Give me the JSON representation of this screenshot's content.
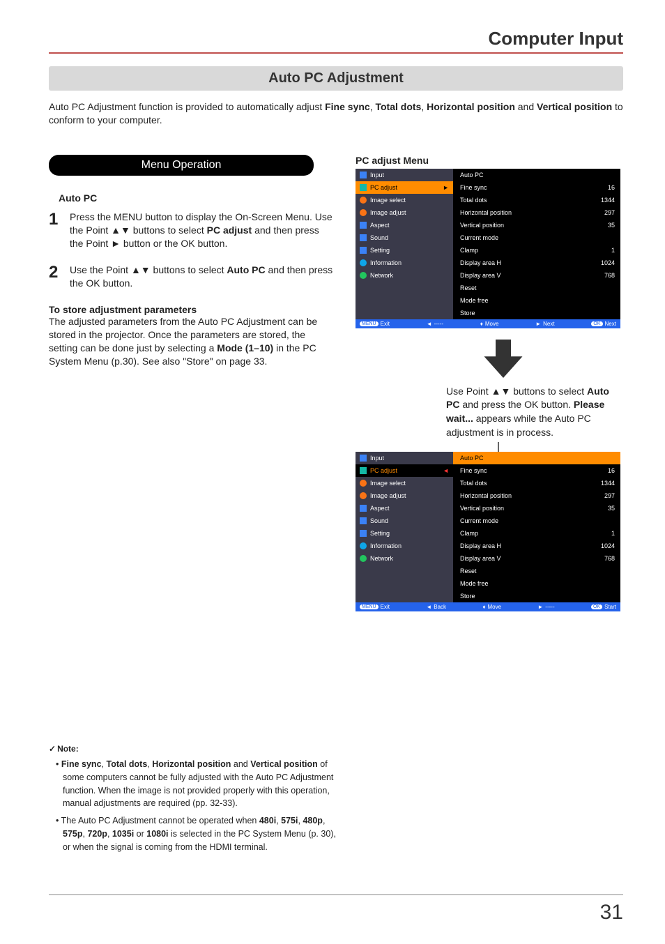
{
  "chapter": "Computer Input",
  "section": "Auto PC Adjustment",
  "intro_parts": [
    "Auto PC Adjustment function is provided to automatically adjust ",
    "Fine sync",
    ", ",
    "Total dots",
    ", ",
    "Horizontal position",
    " and ",
    "Vertical position",
    " to conform to your computer."
  ],
  "menu_operation": "Menu Operation",
  "auto_pc_head": "Auto PC",
  "step1_num": "1",
  "step1_a": "Press the MENU button to display the On-Screen Menu. Use the Point ▲▼ buttons to select ",
  "step1_b": "PC adjust",
  "step1_c": " and then press the Point ► button or the OK button.",
  "step2_num": "2",
  "step2_a": "Use the Point ▲▼ buttons to select ",
  "step2_b": "Auto PC",
  "step2_c": " and then press the OK button.",
  "store_head": "To store adjustment parameters",
  "store_a": "The adjusted parameters from the Auto PC Adjustment can be stored in the projector. Once the parameters are stored, the setting can be done just by selecting a ",
  "store_b": "Mode (1–10)",
  "store_c": " in the PC System Menu (p.30). See also \"Store\" on page 33.",
  "right_head": "PC adjust Menu",
  "osd_menu_items": [
    {
      "label": "Input",
      "icon": "ico-blue"
    },
    {
      "label": "PC adjust",
      "icon": "ico-teal"
    },
    {
      "label": "Image select",
      "icon": "ico-orange"
    },
    {
      "label": "Image adjust",
      "icon": "ico-orange"
    },
    {
      "label": "Aspect",
      "icon": "ico-blue"
    },
    {
      "label": "Sound",
      "icon": "ico-blue"
    },
    {
      "label": "Setting",
      "icon": "ico-blue"
    },
    {
      "label": "Information",
      "icon": "ico-info"
    },
    {
      "label": "Network",
      "icon": "ico-net"
    }
  ],
  "osd_params": [
    {
      "label": "Auto PC",
      "val": ""
    },
    {
      "label": "Fine sync",
      "val": "16"
    },
    {
      "label": "Total dots",
      "val": "1344"
    },
    {
      "label": "Horizontal position",
      "val": "297"
    },
    {
      "label": "Vertical position",
      "val": "35"
    },
    {
      "label": "Current mode",
      "val": ""
    },
    {
      "label": "Clamp",
      "val": "1"
    },
    {
      "label": "Display area H",
      "val": "1024"
    },
    {
      "label": "Display area V",
      "val": "768"
    },
    {
      "label": "Reset",
      "val": ""
    },
    {
      "label": "Mode free",
      "val": ""
    },
    {
      "label": "Store",
      "val": ""
    }
  ],
  "osd_footer1": {
    "exit": "Exit",
    "back": "-----",
    "move": "Move",
    "next": "Next",
    "ok": "Next"
  },
  "osd_footer2": {
    "exit": "Exit",
    "back": "Back",
    "move": "Move",
    "next": "-----",
    "ok": "Start"
  },
  "caption_a": "Use Point ▲▼ buttons to select ",
  "caption_b": "Auto PC",
  "caption_c": " and press the OK button. ",
  "caption_d": "Please wait...",
  "caption_e": " appears while the Auto PC adjustment is in process.",
  "note_head": "Note:",
  "note1_a": "Fine sync",
  "note1_b": ", ",
  "note1_c": "Total dots",
  "note1_d": ", ",
  "note1_e": "Horizontal position",
  "note1_f": " and ",
  "note1_g": "Vertical position",
  "note1_h": " of some computers cannot be fully adjusted with the Auto PC Adjustment function. When the image is not provided properly with this operation, manual adjustments are required (pp. 32-33).",
  "note2_a": "The Auto PC Adjustment cannot be operated when ",
  "note2_b": "480i",
  "note2_c": ", ",
  "note2_d": "575i",
  "note2_e": ", ",
  "note2_f": "480p",
  "note2_g": ", ",
  "note2_h": "575p",
  "note2_i": ", ",
  "note2_j": "720p",
  "note2_k": ", ",
  "note2_l": "1035i",
  "note2_m": " or ",
  "note2_n": "1080i",
  "note2_o": " is selected in the PC System Menu (p. 30), or when the signal is coming from the HDMI terminal.",
  "pagenum": "31"
}
